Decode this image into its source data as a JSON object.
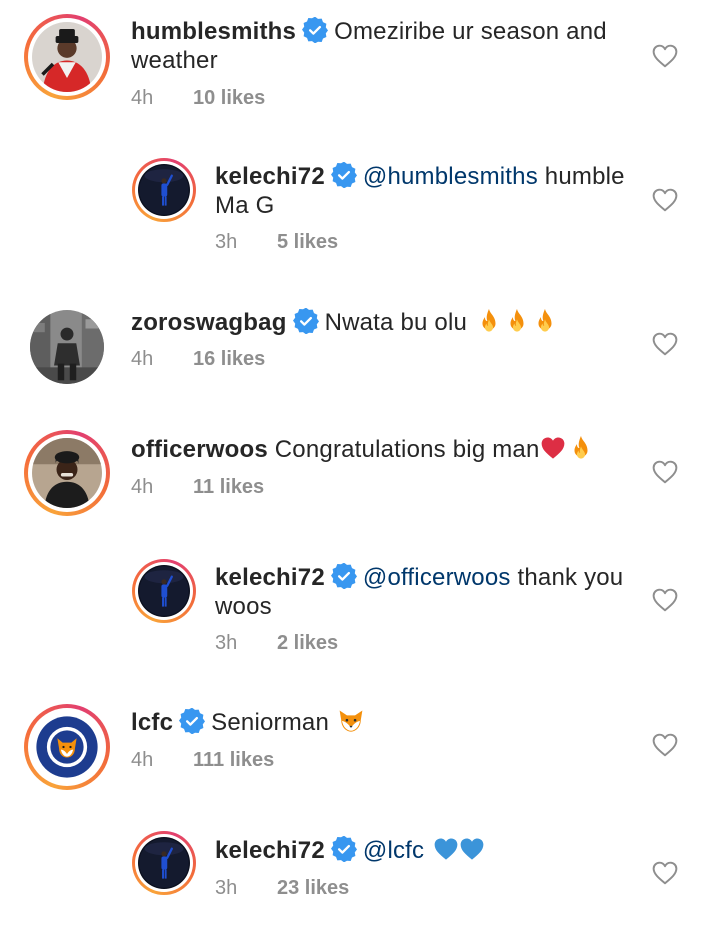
{
  "comments": [
    {
      "username": "humblesmiths",
      "verified": true,
      "mention": "",
      "text_line1": "Omeziribe ur season and",
      "text_line2": "weather",
      "emojis": [],
      "time": "4h",
      "likes": "10 likes",
      "is_reply": false,
      "avatar_icon": "humblesmiths-avatar"
    },
    {
      "username": "kelechi72",
      "verified": true,
      "mention": "@humblesmiths",
      "text_line1": "humble",
      "text_line2": "Ma G",
      "emojis": [],
      "time": "3h",
      "likes": "5 likes",
      "is_reply": true,
      "avatar_icon": "kelechi72-avatar"
    },
    {
      "username": "zoroswagbag",
      "verified": true,
      "mention": "",
      "text_line1": "Nwata bu olu",
      "text_line2": "",
      "emojis": [
        "fire-emoji",
        "fire-emoji",
        "fire-emoji"
      ],
      "time": "4h",
      "likes": "16 likes",
      "is_reply": false,
      "avatar_icon": "zoroswagbag-avatar"
    },
    {
      "username": "officerwoos",
      "verified": false,
      "mention": "",
      "text_line1": "Congratulations big man",
      "text_line2": "",
      "emojis": [
        "red-heart-emoji",
        "fire-emoji"
      ],
      "time": "4h",
      "likes": "11 likes",
      "is_reply": false,
      "avatar_icon": "officerwoos-avatar"
    },
    {
      "username": "kelechi72",
      "verified": true,
      "mention": "@officerwoos",
      "text_line1": "thank you",
      "text_line2": "woos",
      "emojis": [],
      "time": "3h",
      "likes": "2 likes",
      "is_reply": true,
      "avatar_icon": "kelechi72-avatar"
    },
    {
      "username": "lcfc",
      "verified": true,
      "mention": "",
      "text_line1": "Seniorman",
      "text_line2": "",
      "emojis": [
        "fox-emoji"
      ],
      "time": "4h",
      "likes": "111 likes",
      "is_reply": false,
      "avatar_icon": "lcfc-crest-avatar"
    },
    {
      "username": "kelechi72",
      "verified": true,
      "mention": "@lcfc",
      "text_line1": "",
      "text_line2": "",
      "emojis": [
        "blue-heart-emoji",
        "blue-heart-emoji"
      ],
      "time": "3h",
      "likes": "23 likes",
      "is_reply": true,
      "avatar_icon": "kelechi72-avatar"
    }
  ],
  "colors": {
    "username": "#262626",
    "meta": "#8e8e8e",
    "mention": "#00376b",
    "verified_badge": "#3897f0",
    "heart_outline": "#8e8e8e"
  },
  "avatars": {
    "lcfc_crest_text_top": "LEICESTER CITY",
    "lcfc_crest_text_bottom": "FOOTBALL CLUB"
  }
}
